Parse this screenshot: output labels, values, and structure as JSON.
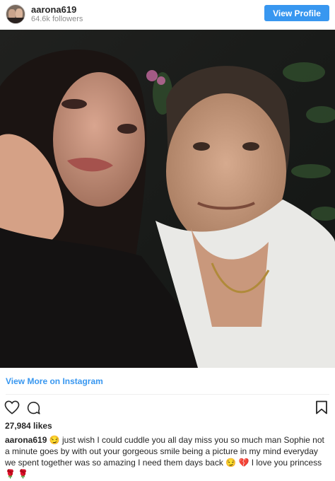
{
  "header": {
    "username": "aarona619",
    "followers": "64.6k followers",
    "view_profile_label": "View Profile"
  },
  "post": {
    "image_alt": "Selfie photo",
    "view_more_label": "View More on Instagram",
    "likes": "27,984 likes",
    "caption_user": "aarona619",
    "caption_text": "😏  just wish I could cuddle you all day miss you so much man Sophie not a minute goes by with out your gorgeous smile being a picture in my mind everyday we spent together was so amazing I need them days back 😏 💔  I love you princess 🌹 🌹"
  },
  "icons": {
    "like": "heart-outline-icon",
    "comment": "comment-bubble-icon",
    "save": "bookmark-icon"
  },
  "colors": {
    "accent": "#3897f0",
    "text": "#262626",
    "muted": "#8e8e8e"
  }
}
